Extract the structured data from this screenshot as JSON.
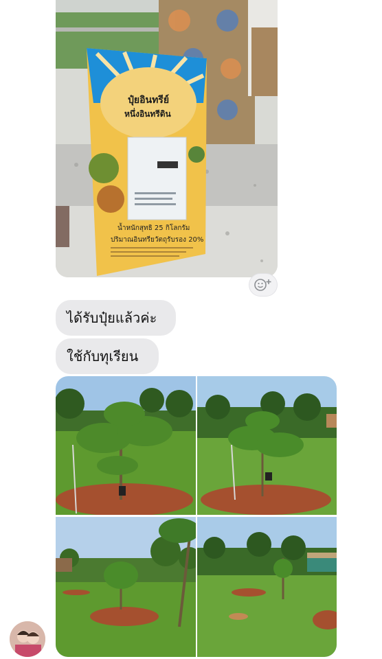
{
  "messages": {
    "bubble_1": "ได้รับปุ๋ยแล้วค่ะ",
    "bubble_2": "ใช้กับทุเรียน"
  },
  "product_bag": {
    "brand": "ปุ๋ยอินทรีย์",
    "subbrand": "หนึ่งอินทรีดิน",
    "weight_text": "น้ำหนักสุทธิ 25 กิโลกรัม",
    "content_text": "ปริมาณอินทรียวัตถุรับรอง 20%"
  },
  "colors": {
    "bubble": "#e9e9eb",
    "background": "#ffffff",
    "bag_yellow": "#f1c24a",
    "bag_blue": "#1e8fd8",
    "soil": "#a5502f",
    "grass": "#5e9a2f",
    "sky": "#9fc4e6"
  },
  "icons": {
    "reaction": "add-reaction-icon"
  }
}
